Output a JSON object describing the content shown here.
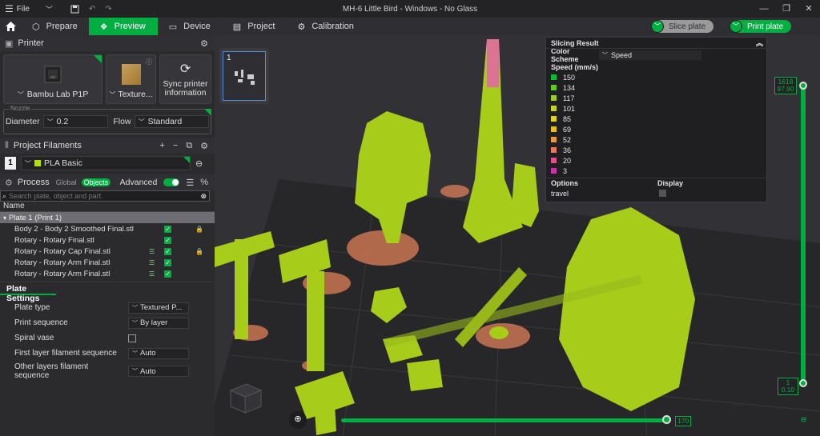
{
  "window": {
    "title": "MH-6 Little Bird - Windows - No Glass",
    "file_menu": "File"
  },
  "tabs": [
    {
      "label": "Prepare",
      "icon": "cube-icon"
    },
    {
      "label": "Preview",
      "icon": "layers-icon",
      "active": true
    },
    {
      "label": "Device",
      "icon": "monitor-icon"
    },
    {
      "label": "Project",
      "icon": "document-icon"
    },
    {
      "label": "Calibration",
      "icon": "gear-icon"
    }
  ],
  "actions": {
    "slice": "Slice plate",
    "print": "Print plate"
  },
  "printer": {
    "section": "Printer",
    "name": "Bambu Lab P1P",
    "plate": "Texture...",
    "sync": "Sync printer information",
    "nozzle_label": "Nozzle",
    "diameter_label": "Diameter",
    "diameter": "0.2",
    "flow_label": "Flow",
    "flow": "Standard"
  },
  "filaments": {
    "section": "Project Filaments",
    "items": [
      {
        "num": "1",
        "name": "PLA Basic",
        "color": "#b7e000"
      }
    ]
  },
  "process": {
    "section": "Process",
    "global": "Global",
    "objects": "Objects",
    "advanced": "Advanced",
    "search_placeholder": "Search plate, object and part.",
    "name_header": "Name",
    "plate": "Plate 1 (Print 1)",
    "rows": [
      "Body 2 - Body 2 Smoothed Final.stl",
      "Rotary - Rotary Final.stl",
      "Rotary - Rotary Cap Final.stl",
      "Rotary - Rotary Arm Final.stl",
      "Rotary - Rotary Arm Final.stl"
    ]
  },
  "plate_settings": {
    "title": "Plate Settings",
    "rows": [
      {
        "label": "Plate type",
        "value": "Textured P..."
      },
      {
        "label": "Print sequence",
        "value": "By layer"
      },
      {
        "label": "Spiral vase",
        "value": ""
      },
      {
        "label": "First layer filament sequence",
        "value": "Auto"
      },
      {
        "label": "Other layers filament sequence",
        "value": "Auto"
      }
    ]
  },
  "thumbnail": {
    "plate_num": "1"
  },
  "slicing": {
    "title": "Slicing Result",
    "scheme_label": "Color Scheme",
    "scheme": "Speed",
    "legend_title": "Speed (mm/s)",
    "legend": [
      {
        "v": "150",
        "c": "#00c030"
      },
      {
        "v": "134",
        "c": "#5ccc20"
      },
      {
        "v": "117",
        "c": "#9acb22"
      },
      {
        "v": "101",
        "c": "#c6d21c"
      },
      {
        "v": "85",
        "c": "#e0d418"
      },
      {
        "v": "69",
        "c": "#e6c018"
      },
      {
        "v": "52",
        "c": "#e89a38"
      },
      {
        "v": "36",
        "c": "#e67a5a"
      },
      {
        "v": "20",
        "c": "#e0508a"
      },
      {
        "v": "3",
        "c": "#d030b0"
      }
    ],
    "options_label": "Options",
    "display_label": "Display",
    "travel": "travel"
  },
  "layers": {
    "top": "1618",
    "top_height": "97.90",
    "bottom": "1",
    "bottom_height": "0.10",
    "moves": "170"
  }
}
